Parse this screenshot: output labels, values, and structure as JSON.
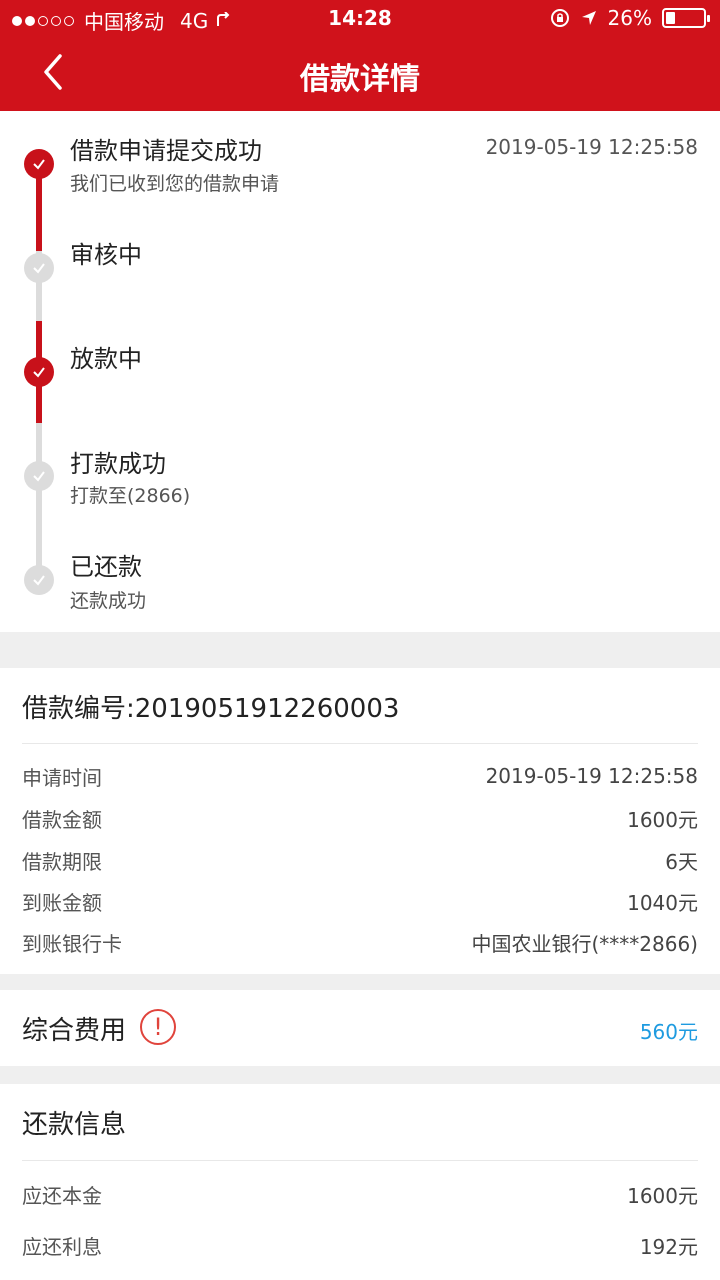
{
  "status_bar": {
    "carrier": "中国移动",
    "network": "4G",
    "time": "14:28",
    "battery": "26%",
    "battery_level": 0.26
  },
  "navbar": {
    "title": "借款详情"
  },
  "steps": [
    {
      "title": "借款申请提交成功",
      "subtitle": "我们已收到您的借款申请",
      "time": "2019-05-19 12:25:58",
      "status": "done"
    },
    {
      "title": "审核中",
      "subtitle": "",
      "time": "",
      "status": "todo"
    },
    {
      "title": "放款中",
      "subtitle": "",
      "time": "",
      "status": "done"
    },
    {
      "title": "打款成功",
      "subtitle": "打款至(2866)",
      "time": "",
      "status": "todo"
    },
    {
      "title": "已还款",
      "subtitle": "还款成功",
      "time": "",
      "status": "todo"
    }
  ],
  "loan": {
    "number_label": "借款编号:2019051912260003",
    "rows": [
      {
        "label": "申请时间",
        "value": "2019-05-19 12:25:58"
      },
      {
        "label": "借款金额",
        "value": "1600元"
      },
      {
        "label": "借款期限",
        "value": "6天"
      },
      {
        "label": "到账金额",
        "value": "1040元"
      },
      {
        "label": "到账银行卡",
        "value": "中国农业银行(****2866)"
      }
    ]
  },
  "fee": {
    "label": "综合费用",
    "icon": "!",
    "value": "560元"
  },
  "repayment": {
    "title": "还款信息",
    "rows": [
      {
        "label": "应还本金",
        "value": "1600元"
      },
      {
        "label": "应还利息",
        "value": "192元"
      }
    ]
  },
  "colors": {
    "brand": "#d0121b",
    "done": "#c8111a",
    "todo": "#dcdcdc",
    "link": "#1e9be0"
  }
}
